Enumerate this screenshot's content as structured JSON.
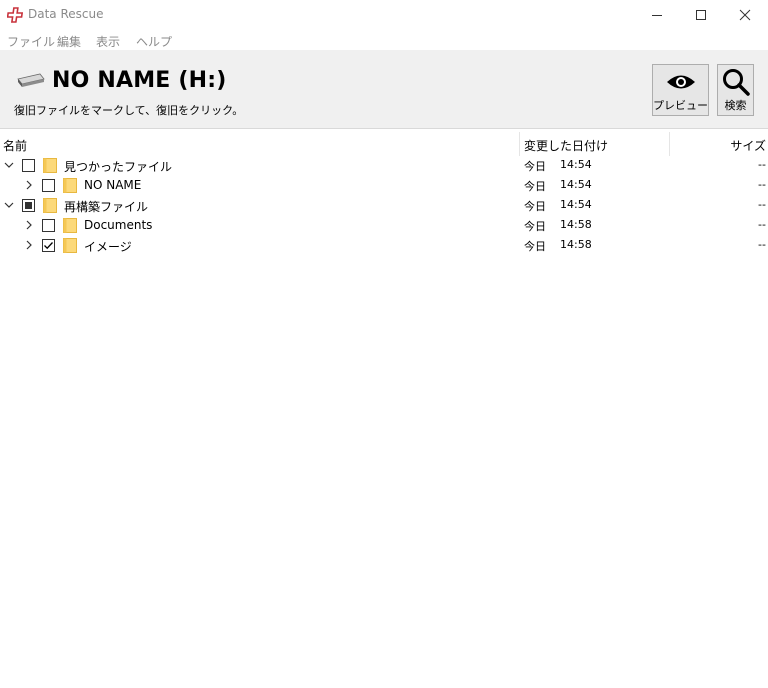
{
  "window": {
    "title": "Data Rescue",
    "accent_color": "#c8323c"
  },
  "menu": {
    "items": [
      "ファイル",
      "編集",
      "表示",
      "ヘルプ"
    ]
  },
  "header": {
    "volume_title": "NO NAME (H:)",
    "instruction": "復旧ファイルをマークして、復旧をクリック。",
    "preview_label": "プレビュー",
    "search_label": "検索"
  },
  "columns": {
    "name": "名前",
    "date": "変更した日付け",
    "size": "サイズ"
  },
  "rows": [
    {
      "name": "見つかったファイル",
      "day": "今日",
      "time": "14:54",
      "size": "--",
      "expanded": true,
      "check": "unchecked",
      "level": 0
    },
    {
      "name": "NO NAME",
      "day": "今日",
      "time": "14:54",
      "size": "--",
      "expanded": false,
      "check": "unchecked",
      "level": 1
    },
    {
      "name": "再構築ファイル",
      "day": "今日",
      "time": "14:54",
      "size": "--",
      "expanded": true,
      "check": "partial",
      "level": 0
    },
    {
      "name": "Documents",
      "day": "今日",
      "time": "14:58",
      "size": "--",
      "expanded": false,
      "check": "unchecked",
      "level": 1
    },
    {
      "name": "イメージ",
      "day": "今日",
      "time": "14:58",
      "size": "--",
      "expanded": false,
      "check": "checked",
      "level": 1
    }
  ]
}
